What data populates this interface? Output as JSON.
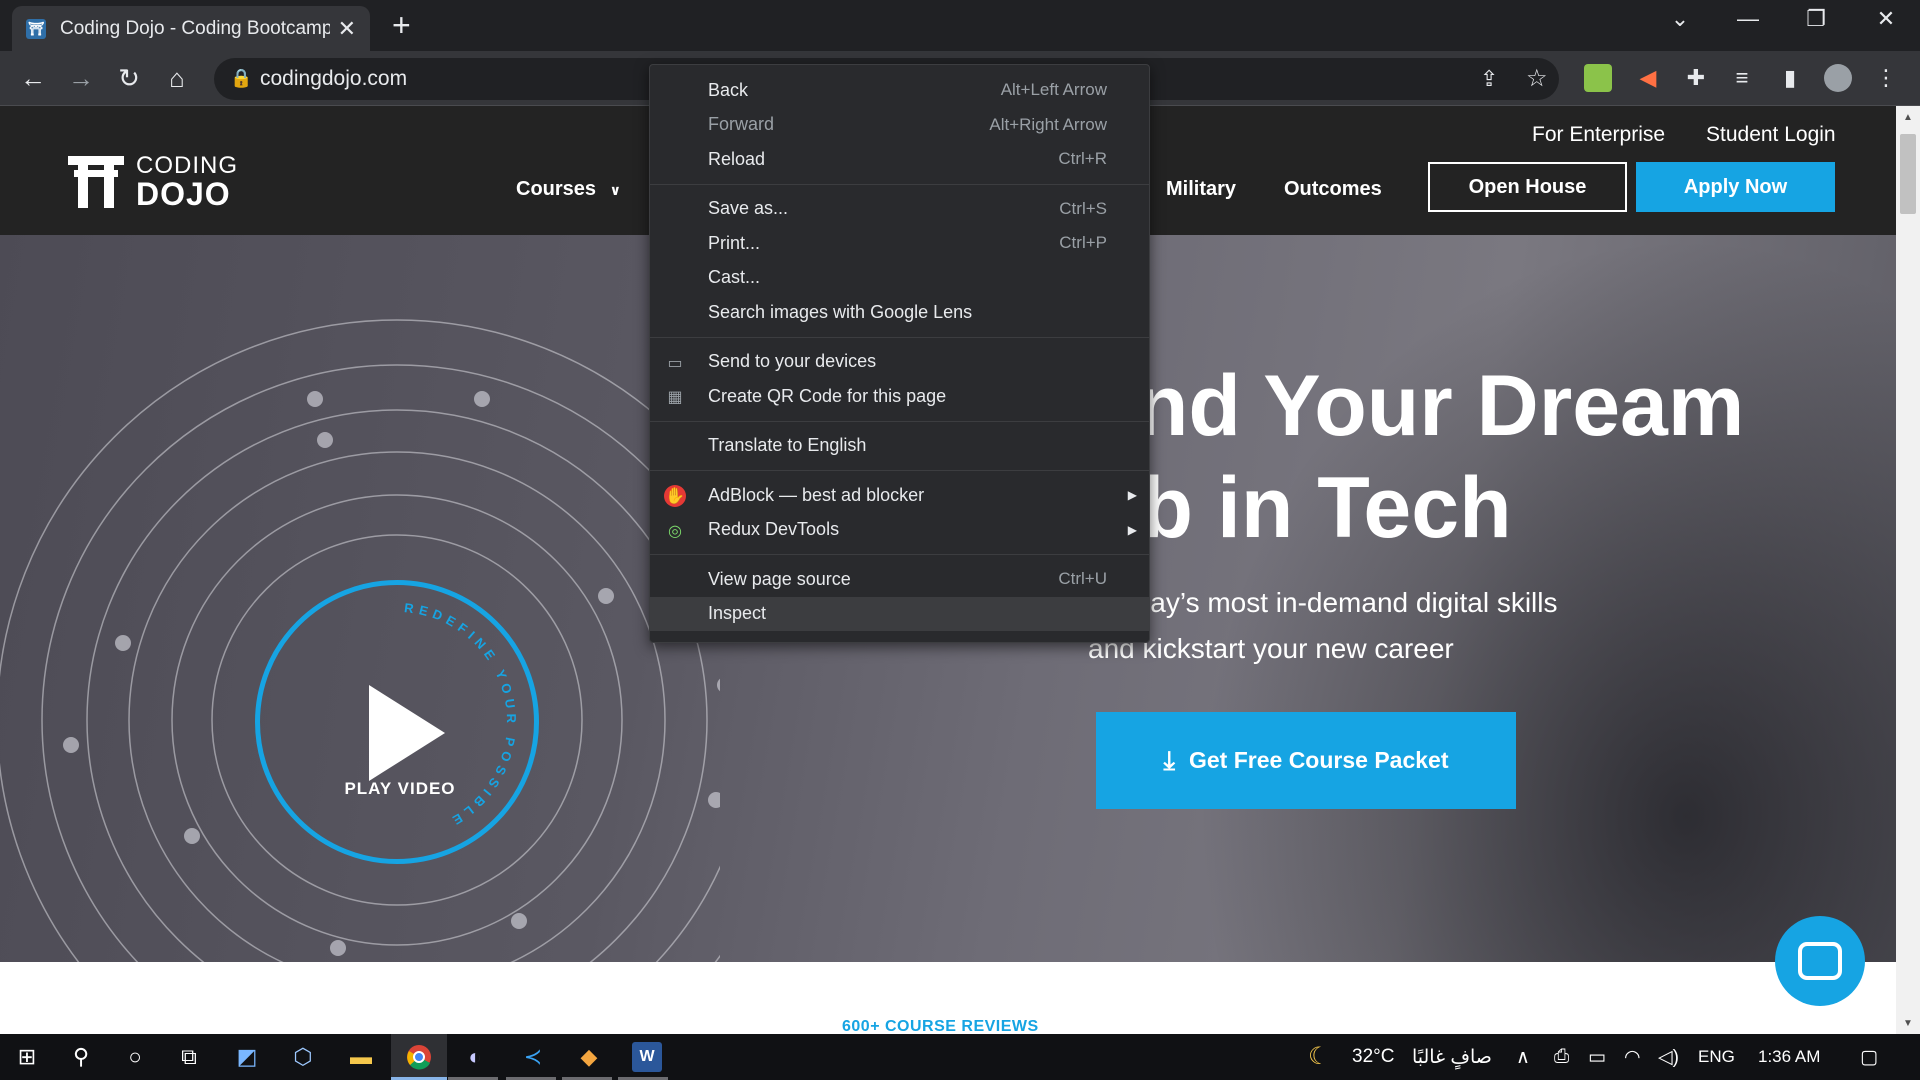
{
  "browser": {
    "tab_title": "Coding Dojo - Coding Bootcamp",
    "tab_close": "✕",
    "new_tab": "+",
    "url": "codingdojo.com",
    "window_controls": [
      "⌄",
      "—",
      "❐",
      "✕"
    ],
    "icons": [
      "back-icon",
      "forward-icon",
      "reload-icon",
      "home-icon",
      "lock-icon",
      "share-icon",
      "bookmark-star-icon",
      "extension-icon",
      "puzzle-icon",
      "media-icon",
      "side-panel-icon",
      "profile-avatar",
      "menu-icon"
    ]
  },
  "site": {
    "logo_line1": "CODING",
    "logo_line2": "DOJO",
    "top_links": [
      "For Enterprise",
      "Student Login"
    ],
    "nav": {
      "courses": "Courses",
      "military": "Military",
      "outcomes": "Outcomes"
    },
    "open_house": "Open House",
    "apply_now": "Apply Now",
    "hero_title": "and Your Dream\nob in Tech",
    "hero_subtitle": "n today’s most in-demand digital skills\nand kickstart your new career",
    "cta": "Get Free Course Packet",
    "play_ring_text": "REDEFINE YOUR POSSIBLE",
    "play_label": "PLAY VIDEO",
    "reviews_label": "600+ COURSE REVIEWS",
    "accent_color": "#16a4e3"
  },
  "context_menu": {
    "groups": [
      [
        {
          "label": "Back",
          "shortcut": "Alt+Left Arrow"
        },
        {
          "label": "Forward",
          "shortcut": "Alt+Right Arrow",
          "disabled": true
        },
        {
          "label": "Reload",
          "shortcut": "Ctrl+R"
        }
      ],
      [
        {
          "label": "Save as...",
          "shortcut": "Ctrl+S"
        },
        {
          "label": "Print...",
          "shortcut": "Ctrl+P"
        },
        {
          "label": "Cast..."
        },
        {
          "label": "Search images with Google Lens"
        }
      ],
      [
        {
          "label": "Send to your devices",
          "icon": "devices-icon"
        },
        {
          "label": "Create QR Code for this page",
          "icon": "qr-code-icon"
        }
      ],
      [
        {
          "label": "Translate to English"
        }
      ],
      [
        {
          "label": "AdBlock — best ad blocker",
          "icon": "adblock-icon",
          "submenu": true
        },
        {
          "label": "Redux DevTools",
          "icon": "redux-icon",
          "submenu": true
        }
      ],
      [
        {
          "label": "View page source",
          "shortcut": "Ctrl+U"
        },
        {
          "label": "Inspect",
          "highlighted": true
        }
      ]
    ]
  },
  "taskbar": {
    "temperature": "32°C",
    "weather_text": "صافٍ غالبًا",
    "language": "ENG",
    "time": "1:36 AM",
    "apps": [
      "start-icon",
      "search-icon",
      "cortana-icon",
      "task-view-icon",
      "kubernetes-icon",
      "virtualbox-icon",
      "file-explorer-icon",
      "chrome-icon",
      "eclipse-icon",
      "vscode-icon",
      "git-icon",
      "word-icon"
    ]
  }
}
